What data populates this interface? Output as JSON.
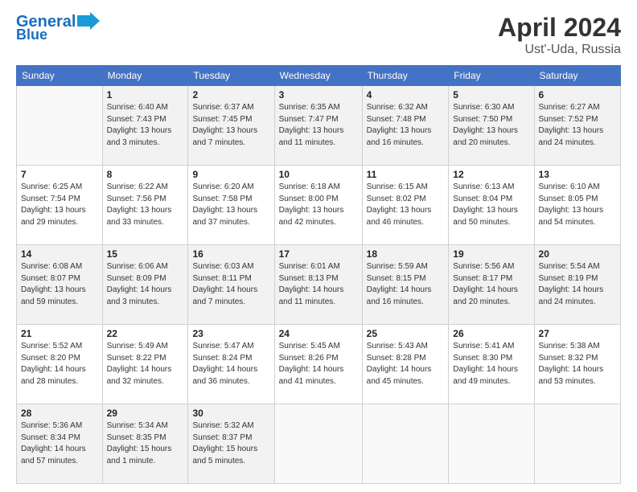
{
  "header": {
    "logo_line1": "General",
    "logo_line2": "Blue",
    "month_title": "April 2024",
    "location": "Ust'-Uda, Russia"
  },
  "days_of_week": [
    "Sunday",
    "Monday",
    "Tuesday",
    "Wednesday",
    "Thursday",
    "Friday",
    "Saturday"
  ],
  "weeks": [
    [
      {
        "day": "",
        "sunrise": "",
        "sunset": "",
        "daylight": ""
      },
      {
        "day": "1",
        "sunrise": "Sunrise: 6:40 AM",
        "sunset": "Sunset: 7:43 PM",
        "daylight": "Daylight: 13 hours and 3 minutes."
      },
      {
        "day": "2",
        "sunrise": "Sunrise: 6:37 AM",
        "sunset": "Sunset: 7:45 PM",
        "daylight": "Daylight: 13 hours and 7 minutes."
      },
      {
        "day": "3",
        "sunrise": "Sunrise: 6:35 AM",
        "sunset": "Sunset: 7:47 PM",
        "daylight": "Daylight: 13 hours and 11 minutes."
      },
      {
        "day": "4",
        "sunrise": "Sunrise: 6:32 AM",
        "sunset": "Sunset: 7:48 PM",
        "daylight": "Daylight: 13 hours and 16 minutes."
      },
      {
        "day": "5",
        "sunrise": "Sunrise: 6:30 AM",
        "sunset": "Sunset: 7:50 PM",
        "daylight": "Daylight: 13 hours and 20 minutes."
      },
      {
        "day": "6",
        "sunrise": "Sunrise: 6:27 AM",
        "sunset": "Sunset: 7:52 PM",
        "daylight": "Daylight: 13 hours and 24 minutes."
      }
    ],
    [
      {
        "day": "7",
        "sunrise": "Sunrise: 6:25 AM",
        "sunset": "Sunset: 7:54 PM",
        "daylight": "Daylight: 13 hours and 29 minutes."
      },
      {
        "day": "8",
        "sunrise": "Sunrise: 6:22 AM",
        "sunset": "Sunset: 7:56 PM",
        "daylight": "Daylight: 13 hours and 33 minutes."
      },
      {
        "day": "9",
        "sunrise": "Sunrise: 6:20 AM",
        "sunset": "Sunset: 7:58 PM",
        "daylight": "Daylight: 13 hours and 37 minutes."
      },
      {
        "day": "10",
        "sunrise": "Sunrise: 6:18 AM",
        "sunset": "Sunset: 8:00 PM",
        "daylight": "Daylight: 13 hours and 42 minutes."
      },
      {
        "day": "11",
        "sunrise": "Sunrise: 6:15 AM",
        "sunset": "Sunset: 8:02 PM",
        "daylight": "Daylight: 13 hours and 46 minutes."
      },
      {
        "day": "12",
        "sunrise": "Sunrise: 6:13 AM",
        "sunset": "Sunset: 8:04 PM",
        "daylight": "Daylight: 13 hours and 50 minutes."
      },
      {
        "day": "13",
        "sunrise": "Sunrise: 6:10 AM",
        "sunset": "Sunset: 8:05 PM",
        "daylight": "Daylight: 13 hours and 54 minutes."
      }
    ],
    [
      {
        "day": "14",
        "sunrise": "Sunrise: 6:08 AM",
        "sunset": "Sunset: 8:07 PM",
        "daylight": "Daylight: 13 hours and 59 minutes."
      },
      {
        "day": "15",
        "sunrise": "Sunrise: 6:06 AM",
        "sunset": "Sunset: 8:09 PM",
        "daylight": "Daylight: 14 hours and 3 minutes."
      },
      {
        "day": "16",
        "sunrise": "Sunrise: 6:03 AM",
        "sunset": "Sunset: 8:11 PM",
        "daylight": "Daylight: 14 hours and 7 minutes."
      },
      {
        "day": "17",
        "sunrise": "Sunrise: 6:01 AM",
        "sunset": "Sunset: 8:13 PM",
        "daylight": "Daylight: 14 hours and 11 minutes."
      },
      {
        "day": "18",
        "sunrise": "Sunrise: 5:59 AM",
        "sunset": "Sunset: 8:15 PM",
        "daylight": "Daylight: 14 hours and 16 minutes."
      },
      {
        "day": "19",
        "sunrise": "Sunrise: 5:56 AM",
        "sunset": "Sunset: 8:17 PM",
        "daylight": "Daylight: 14 hours and 20 minutes."
      },
      {
        "day": "20",
        "sunrise": "Sunrise: 5:54 AM",
        "sunset": "Sunset: 8:19 PM",
        "daylight": "Daylight: 14 hours and 24 minutes."
      }
    ],
    [
      {
        "day": "21",
        "sunrise": "Sunrise: 5:52 AM",
        "sunset": "Sunset: 8:20 PM",
        "daylight": "Daylight: 14 hours and 28 minutes."
      },
      {
        "day": "22",
        "sunrise": "Sunrise: 5:49 AM",
        "sunset": "Sunset: 8:22 PM",
        "daylight": "Daylight: 14 hours and 32 minutes."
      },
      {
        "day": "23",
        "sunrise": "Sunrise: 5:47 AM",
        "sunset": "Sunset: 8:24 PM",
        "daylight": "Daylight: 14 hours and 36 minutes."
      },
      {
        "day": "24",
        "sunrise": "Sunrise: 5:45 AM",
        "sunset": "Sunset: 8:26 PM",
        "daylight": "Daylight: 14 hours and 41 minutes."
      },
      {
        "day": "25",
        "sunrise": "Sunrise: 5:43 AM",
        "sunset": "Sunset: 8:28 PM",
        "daylight": "Daylight: 14 hours and 45 minutes."
      },
      {
        "day": "26",
        "sunrise": "Sunrise: 5:41 AM",
        "sunset": "Sunset: 8:30 PM",
        "daylight": "Daylight: 14 hours and 49 minutes."
      },
      {
        "day": "27",
        "sunrise": "Sunrise: 5:38 AM",
        "sunset": "Sunset: 8:32 PM",
        "daylight": "Daylight: 14 hours and 53 minutes."
      }
    ],
    [
      {
        "day": "28",
        "sunrise": "Sunrise: 5:36 AM",
        "sunset": "Sunset: 8:34 PM",
        "daylight": "Daylight: 14 hours and 57 minutes."
      },
      {
        "day": "29",
        "sunrise": "Sunrise: 5:34 AM",
        "sunset": "Sunset: 8:35 PM",
        "daylight": "Daylight: 15 hours and 1 minute."
      },
      {
        "day": "30",
        "sunrise": "Sunrise: 5:32 AM",
        "sunset": "Sunset: 8:37 PM",
        "daylight": "Daylight: 15 hours and 5 minutes."
      },
      {
        "day": "",
        "sunrise": "",
        "sunset": "",
        "daylight": ""
      },
      {
        "day": "",
        "sunrise": "",
        "sunset": "",
        "daylight": ""
      },
      {
        "day": "",
        "sunrise": "",
        "sunset": "",
        "daylight": ""
      },
      {
        "day": "",
        "sunrise": "",
        "sunset": "",
        "daylight": ""
      }
    ]
  ]
}
